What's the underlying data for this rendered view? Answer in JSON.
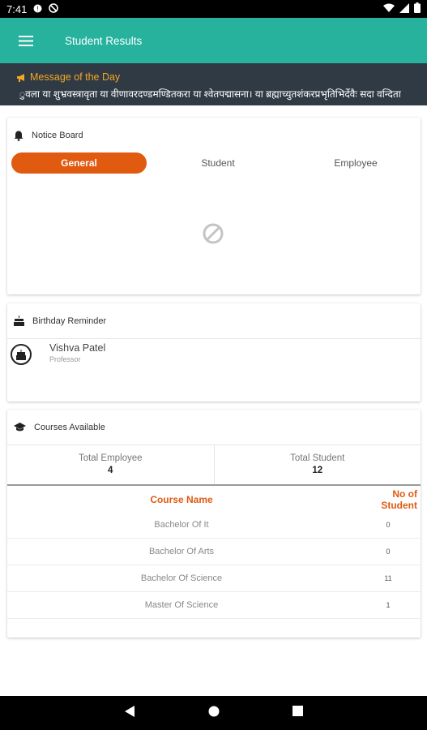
{
  "status_bar": {
    "time": "7:41"
  },
  "app_bar": {
    "title": "Student Results"
  },
  "motd": {
    "label": "Message of the Day",
    "text": "ुवला या शुभ्रवस्त्रावृता या वीणावरदण्डमण्डितकरा या श्वेतपद्मासना। या ब्रह्माच्युतशंकरप्रभृतिभिर्देवैः सदा वन्दिता"
  },
  "notice_board": {
    "title": "Notice Board",
    "tabs": [
      "General",
      "Student",
      "Employee"
    ],
    "active_tab": "General"
  },
  "birthday": {
    "title": "Birthday Reminder",
    "people": [
      {
        "name": "Vishva Patel",
        "role": "Professor"
      }
    ]
  },
  "courses": {
    "title": "Courses Available",
    "stats": [
      {
        "label": "Total Employee",
        "value": "4"
      },
      {
        "label": "Total Student",
        "value": "12"
      }
    ],
    "columns": {
      "name": "Course Name",
      "count": "No of Student"
    },
    "rows": [
      {
        "name": "Bachelor Of It",
        "count": "0"
      },
      {
        "name": "Bachelor Of Arts",
        "count": "0"
      },
      {
        "name": "Bachelor Of Science",
        "count": "11"
      },
      {
        "name": "Master Of Science",
        "count": "1"
      }
    ]
  },
  "colors": {
    "primary": "#26b29d",
    "accent": "#e05a10",
    "motd_bg": "#2f3a44",
    "motd_label": "#f5a623"
  }
}
